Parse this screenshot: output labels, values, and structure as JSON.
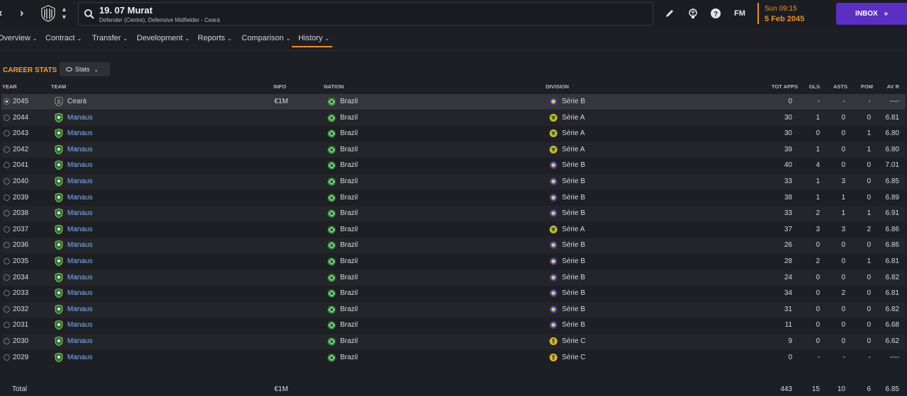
{
  "header": {
    "player_name": "19. 07 Murat",
    "player_subtitle": "Defender (Centre), Defensive Midfielder - Ceará",
    "clock_time": "Sun 09:15",
    "clock_date": "5 Feb 2045",
    "inbox_label": "INBOX",
    "fm_label": "FM",
    "accent": "#e8912a",
    "inbox_color": "#5b2fc4"
  },
  "tabs": [
    {
      "label": "Overview",
      "active": false
    },
    {
      "label": "Contract",
      "active": false
    },
    {
      "label": "Transfer",
      "active": false
    },
    {
      "label": "Development",
      "active": false
    },
    {
      "label": "Reports",
      "active": false
    },
    {
      "label": "Comparison",
      "active": false
    },
    {
      "label": "History",
      "active": true
    }
  ],
  "section": {
    "title": "CAREER STATS",
    "view_button": "Stats"
  },
  "columns": {
    "year": "YEAR",
    "team": "TEAM",
    "info": "INFO",
    "nation": "NATION",
    "division": "DIVISION",
    "tot_apps": "TOT APPS",
    "gls": "GLS",
    "asts": "ASTS",
    "pom": "POM",
    "av_r": "AV R"
  },
  "rows": [
    {
      "year": "2045",
      "team": "Ceará",
      "info": "€1M",
      "nation": "Brazil",
      "division": "Série B",
      "apps": "0",
      "gls": "-",
      "asts": "-",
      "pom": "-",
      "avr": "----"
    },
    {
      "year": "2044",
      "team": "Manaus",
      "info": "",
      "nation": "Brazil",
      "division": "Série A",
      "apps": "30",
      "gls": "1",
      "asts": "0",
      "pom": "0",
      "avr": "6.81"
    },
    {
      "year": "2043",
      "team": "Manaus",
      "info": "",
      "nation": "Brazil",
      "division": "Série A",
      "apps": "30",
      "gls": "0",
      "asts": "0",
      "pom": "1",
      "avr": "6.80"
    },
    {
      "year": "2042",
      "team": "Manaus",
      "info": "",
      "nation": "Brazil",
      "division": "Série A",
      "apps": "39",
      "gls": "1",
      "asts": "0",
      "pom": "1",
      "avr": "6.80"
    },
    {
      "year": "2041",
      "team": "Manaus",
      "info": "",
      "nation": "Brazil",
      "division": "Série B",
      "apps": "40",
      "gls": "4",
      "asts": "0",
      "pom": "0",
      "avr": "7.01"
    },
    {
      "year": "2040",
      "team": "Manaus",
      "info": "",
      "nation": "Brazil",
      "division": "Série B",
      "apps": "33",
      "gls": "1",
      "asts": "3",
      "pom": "0",
      "avr": "6.85"
    },
    {
      "year": "2039",
      "team": "Manaus",
      "info": "",
      "nation": "Brazil",
      "division": "Série B",
      "apps": "38",
      "gls": "1",
      "asts": "1",
      "pom": "0",
      "avr": "6.89"
    },
    {
      "year": "2038",
      "team": "Manaus",
      "info": "",
      "nation": "Brazil",
      "division": "Série B",
      "apps": "33",
      "gls": "2",
      "asts": "1",
      "pom": "1",
      "avr": "6.91"
    },
    {
      "year": "2037",
      "team": "Manaus",
      "info": "",
      "nation": "Brazil",
      "division": "Série A",
      "apps": "37",
      "gls": "3",
      "asts": "3",
      "pom": "2",
      "avr": "6.86"
    },
    {
      "year": "2036",
      "team": "Manaus",
      "info": "",
      "nation": "Brazil",
      "division": "Série B",
      "apps": "26",
      "gls": "0",
      "asts": "0",
      "pom": "0",
      "avr": "6.86"
    },
    {
      "year": "2035",
      "team": "Manaus",
      "info": "",
      "nation": "Brazil",
      "division": "Série B",
      "apps": "28",
      "gls": "2",
      "asts": "0",
      "pom": "1",
      "avr": "6.81"
    },
    {
      "year": "2034",
      "team": "Manaus",
      "info": "",
      "nation": "Brazil",
      "division": "Série B",
      "apps": "24",
      "gls": "0",
      "asts": "0",
      "pom": "0",
      "avr": "6.82"
    },
    {
      "year": "2033",
      "team": "Manaus",
      "info": "",
      "nation": "Brazil",
      "division": "Série B",
      "apps": "34",
      "gls": "0",
      "asts": "2",
      "pom": "0",
      "avr": "6.81"
    },
    {
      "year": "2032",
      "team": "Manaus",
      "info": "",
      "nation": "Brazil",
      "division": "Série B",
      "apps": "31",
      "gls": "0",
      "asts": "0",
      "pom": "0",
      "avr": "6.82"
    },
    {
      "year": "2031",
      "team": "Manaus",
      "info": "",
      "nation": "Brazil",
      "division": "Série B",
      "apps": "11",
      "gls": "0",
      "asts": "0",
      "pom": "0",
      "avr": "6.68"
    },
    {
      "year": "2030",
      "team": "Manaus",
      "info": "",
      "nation": "Brazil",
      "division": "Série C",
      "apps": "9",
      "gls": "0",
      "asts": "0",
      "pom": "0",
      "avr": "6.62"
    },
    {
      "year": "2029",
      "team": "Manaus",
      "info": "",
      "nation": "Brazil",
      "division": "Série C",
      "apps": "0",
      "gls": "-",
      "asts": "-",
      "pom": "-",
      "avr": "----"
    }
  ],
  "total": {
    "label": "Total",
    "info": "€1M",
    "apps": "443",
    "gls": "15",
    "asts": "10",
    "pom": "6",
    "avr": "6.85"
  }
}
